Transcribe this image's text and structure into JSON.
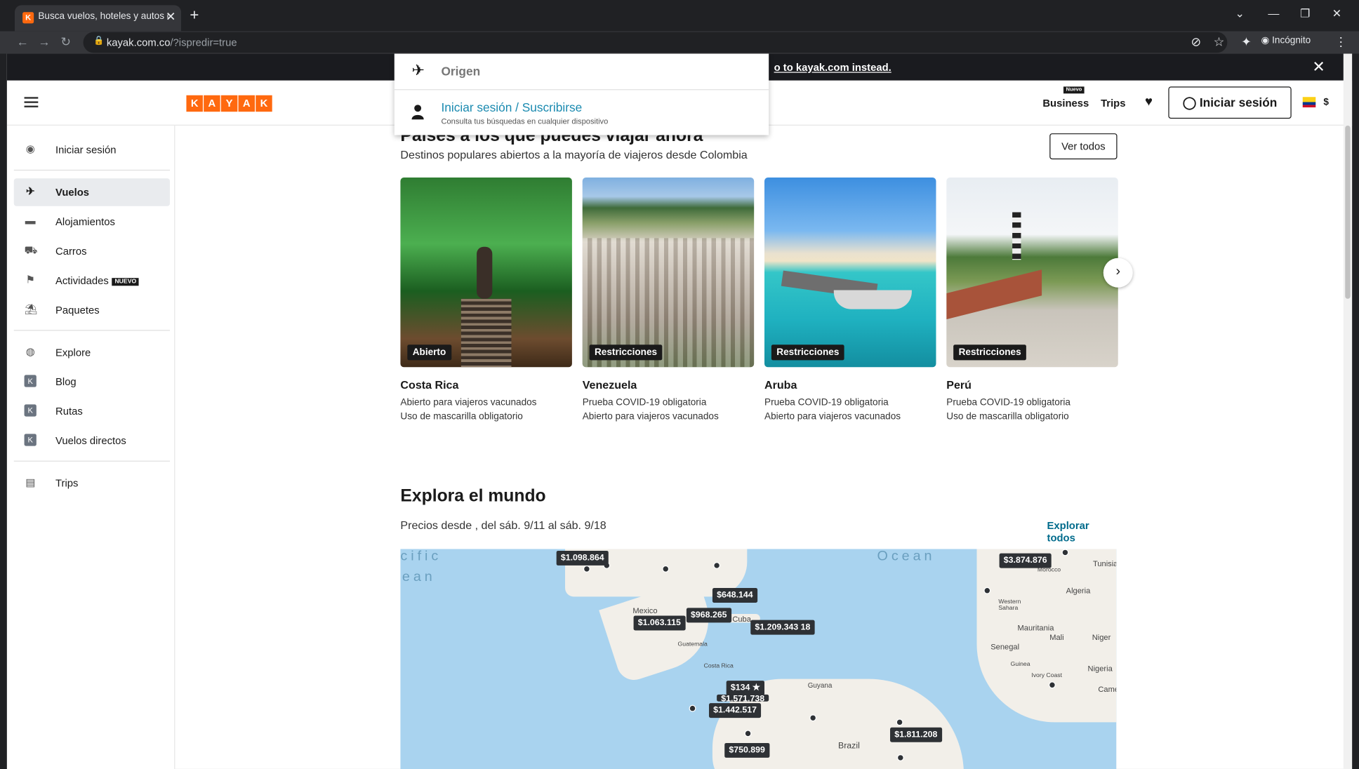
{
  "browser": {
    "tab_title": "Busca vuelos, hoteles y autos de",
    "tab_favicon": "K",
    "url_host": "kayak.com.co",
    "url_path": "/?ispredir=true",
    "incognito_label": "Incógnito"
  },
  "banner": {
    "text": "o to kayak.com instead."
  },
  "header": {
    "logo_letters": [
      "K",
      "A",
      "Y",
      "A",
      "K"
    ],
    "business": "Business",
    "business_badge": "Nuevo",
    "trips": "Trips",
    "signin": "Iniciar sesión",
    "currency": "$"
  },
  "dropdown": {
    "origen": "Origen",
    "signin_link": "Iniciar sesión / Suscribirse",
    "signin_sub": "Consulta tus búsquedas en cualquier dispositivo"
  },
  "sidebar": {
    "signin": "Iniciar sesión",
    "items": [
      {
        "label": "Vuelos",
        "icon": "plane-icon"
      },
      {
        "label": "Alojamientos",
        "icon": "bed-icon"
      },
      {
        "label": "Carros",
        "icon": "car-icon"
      },
      {
        "label": "Actividades",
        "icon": "signpost-icon",
        "badge": "NUEVO"
      },
      {
        "label": "Paquetes",
        "icon": "beach-icon"
      }
    ],
    "items2": [
      {
        "label": "Explore",
        "icon": "globe-icon"
      },
      {
        "label": "Blog",
        "icon": "kayak-k-icon"
      },
      {
        "label": "Rutas",
        "icon": "kayak-k-icon"
      },
      {
        "label": "Vuelos directos",
        "icon": "kayak-k-icon"
      }
    ],
    "trips": "Trips"
  },
  "countries": {
    "title": "Países a los que puedes viajar ahora",
    "subtitle": "Destinos populares abiertos a la mayoría de viajeros desde Colombia",
    "ver_todos": "Ver todos",
    "cards": [
      {
        "name": "Costa Rica",
        "tag": "Abierto",
        "l1": "Abierto para viajeros vacunados",
        "l2": "Uso de mascarilla obligatorio"
      },
      {
        "name": "Venezuela",
        "tag": "Restricciones",
        "l1": "Prueba COVID-19 obligatoria",
        "l2": "Abierto para viajeros vacunados"
      },
      {
        "name": "Aruba",
        "tag": "Restricciones",
        "l1": "Prueba COVID-19 obligatoria",
        "l2": "Abierto para viajeros vacunados"
      },
      {
        "name": "Perú",
        "tag": "Restricciones",
        "l1": "Prueba COVID-19 obligatoria",
        "l2": "Uso de mascarilla obligatorio"
      }
    ]
  },
  "explore": {
    "title": "Explora el mundo",
    "subtitle": "Precios desde , del sáb. 9/11 al sáb. 9/18",
    "link": "Explorar todos",
    "prices": [
      "$1.098.864",
      "$648.144",
      "$968.265",
      "$1.063.115",
      "$1.209.343",
      "18",
      "$3.874.876",
      "$134",
      "$1.571.738",
      "$1.442.517",
      "$1.811.208",
      "$750.899"
    ],
    "labels": [
      "Mexico",
      "Cuba",
      "Guatemala",
      "Costa Rica",
      "Guyana",
      "Brazil",
      "Algeria",
      "Western Sahara",
      "Mauritania",
      "Mali",
      "Niger",
      "Senegal",
      "Guinea",
      "Ivory Coast",
      "Nigeria",
      "Cameroon",
      "Tunisia",
      "Morocco"
    ],
    "ocean": [
      "cific",
      "ean",
      "Ocean"
    ]
  }
}
